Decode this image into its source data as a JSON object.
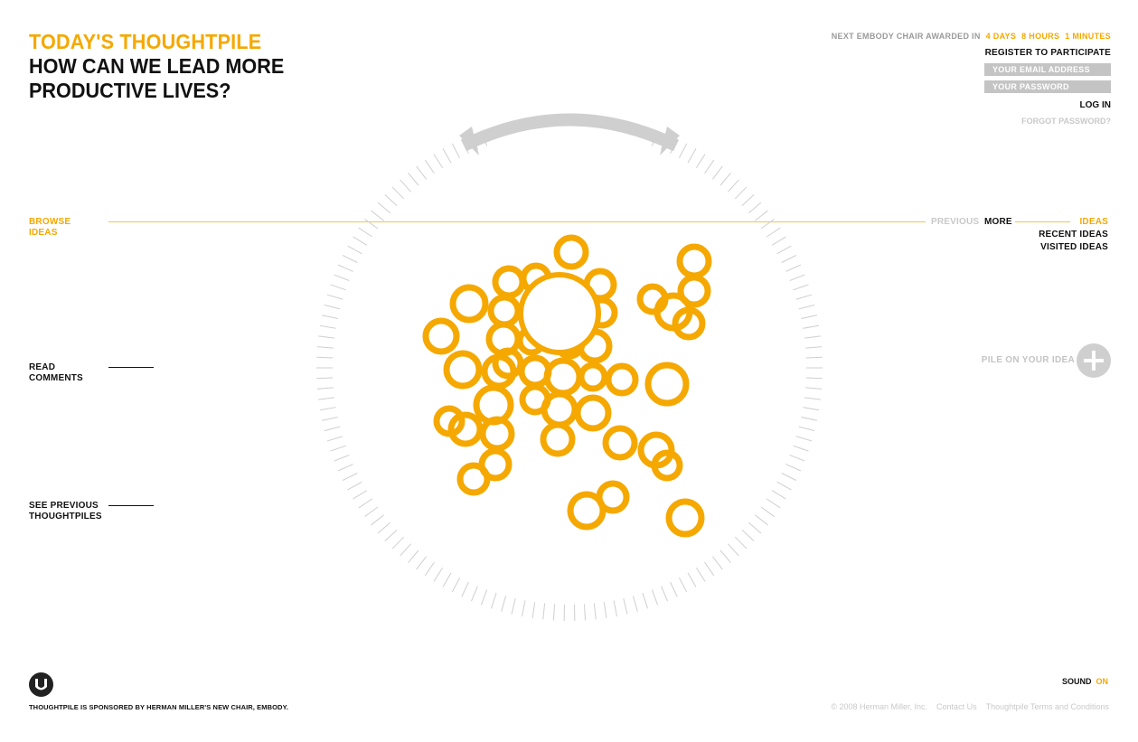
{
  "header": {
    "kicker": "TODAY'S THOUGHTPILE",
    "question_line1": "HOW CAN WE LEAD MORE",
    "question_line2": "PRODUCTIVE LIVES?"
  },
  "account": {
    "countdown_label": "NEXT EMBODY CHAIR AWARDED IN",
    "days": "4 DAYS",
    "hours": "8 HOURS",
    "minutes": "1 MINUTES",
    "register": "REGISTER TO PARTICIPATE",
    "email_placeholder": "YOUR EMAIL ADDRESS",
    "password_placeholder": "YOUR PASSWORD",
    "login": "LOG IN",
    "forgot": "FORGOT PASSWORD?"
  },
  "left_nav": {
    "browse_1": "BROWSE",
    "browse_2": "IDEAS",
    "comments_1": "READ",
    "comments_2": "COMMENTS",
    "previous_1": "SEE PREVIOUS",
    "previous_2": "THOUGHTPILES"
  },
  "right_nav": {
    "previous": "PREVIOUS",
    "more": "MORE",
    "ideas": "IDEAS",
    "recent": "RECENT IDEAS",
    "visited": "VISITED IDEAS",
    "pile_on": "PILE ON YOUR IDEA"
  },
  "footer": {
    "sponsor": "THOUGHTPILE IS SPONSORED BY HERMAN MILLER'S NEW CHAIR, EMBODY.",
    "sound_label": "SOUND",
    "sound_state": "ON",
    "copyright": "© 2008 Herman Miller, Inc.",
    "contact": "Contact Us",
    "terms": "Thoughtpile Terms and Conditions"
  },
  "colors": {
    "accent": "#f5a800",
    "muted": "#c4c4c4",
    "ink": "#111111"
  },
  "icons": {
    "rotate": "double-headed-curved-arrow",
    "add": "plus-circle",
    "logo": "herman-miller-logo"
  },
  "ideas_count": 46
}
